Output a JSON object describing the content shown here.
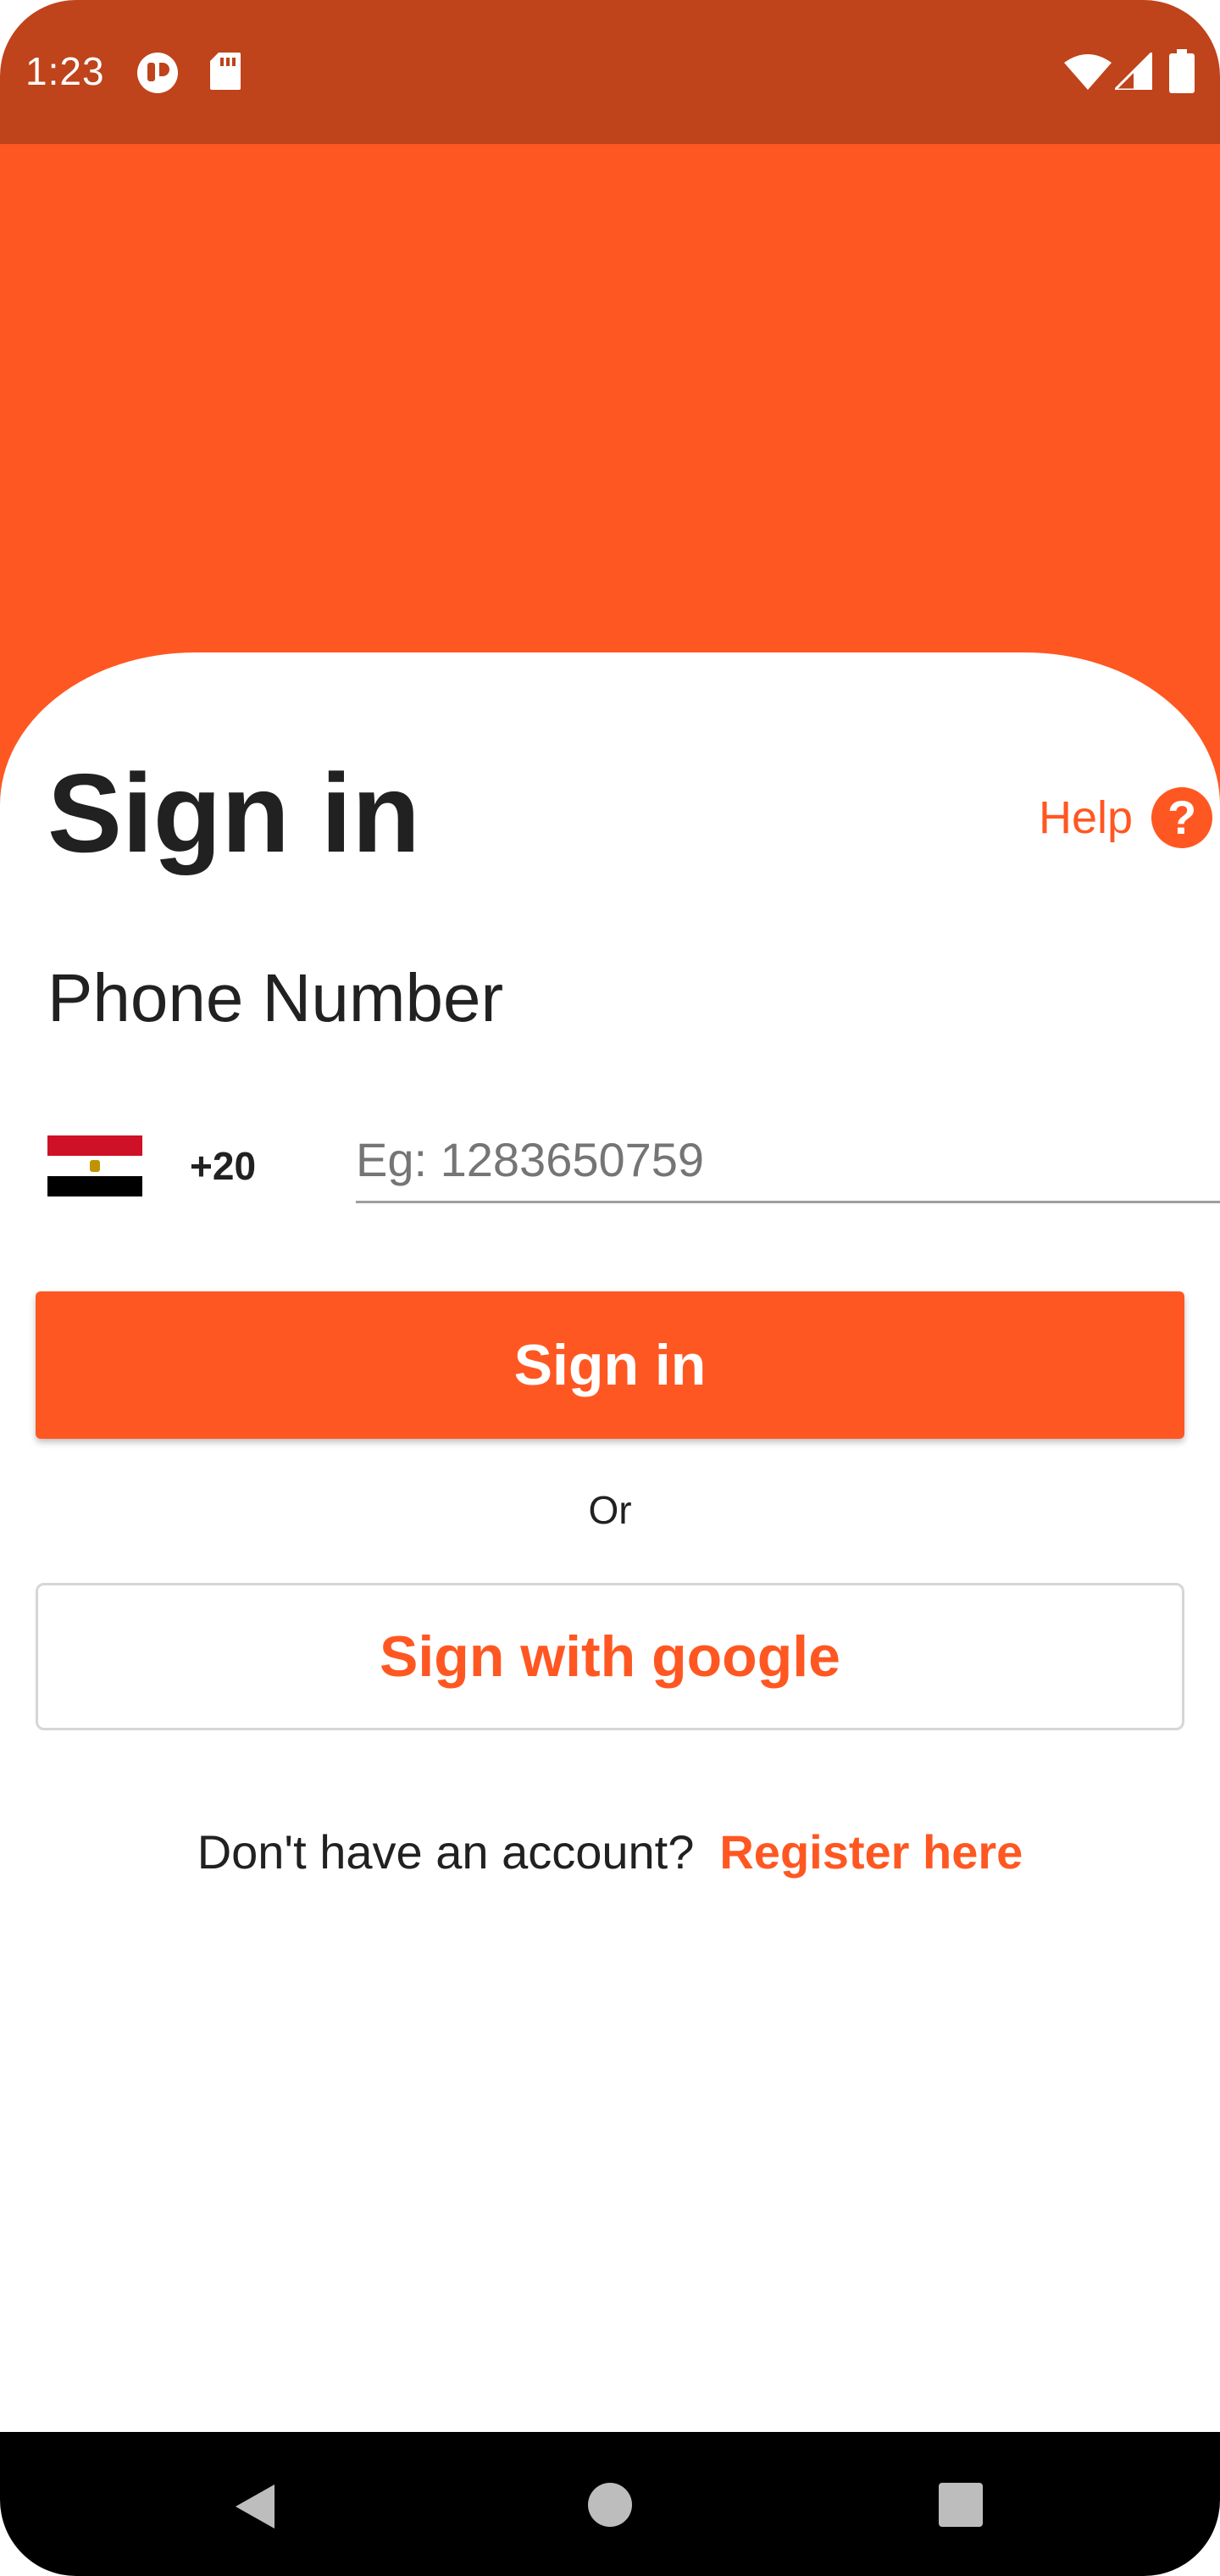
{
  "status_bar": {
    "time": "1:23",
    "left_icons": [
      "notification-app-icon",
      "sd-card-icon"
    ],
    "right_icons": [
      "wifi-icon",
      "signal-icon",
      "battery-icon"
    ],
    "color": "#BF431B"
  },
  "header": {
    "color": "#FF5722"
  },
  "signin": {
    "title": "Sign in",
    "help_label": "Help",
    "help_icon_glyph": "?",
    "phone_label": "Phone Number",
    "country_flag": "egypt-flag-icon",
    "dial_code": "+20",
    "phone_placeholder": "Eg: 1283650759",
    "phone_value": "",
    "signin_button": "Sign in",
    "or_text": "Or",
    "google_button": "Sign with google",
    "register_prompt": "Don't have an account?",
    "register_link": "Register here"
  },
  "colors": {
    "accent": "#FF5722",
    "text": "#212121",
    "nav_bar": "#000000"
  },
  "nav_bar": {
    "buttons": [
      "back-icon",
      "home-icon",
      "recents-icon"
    ]
  }
}
